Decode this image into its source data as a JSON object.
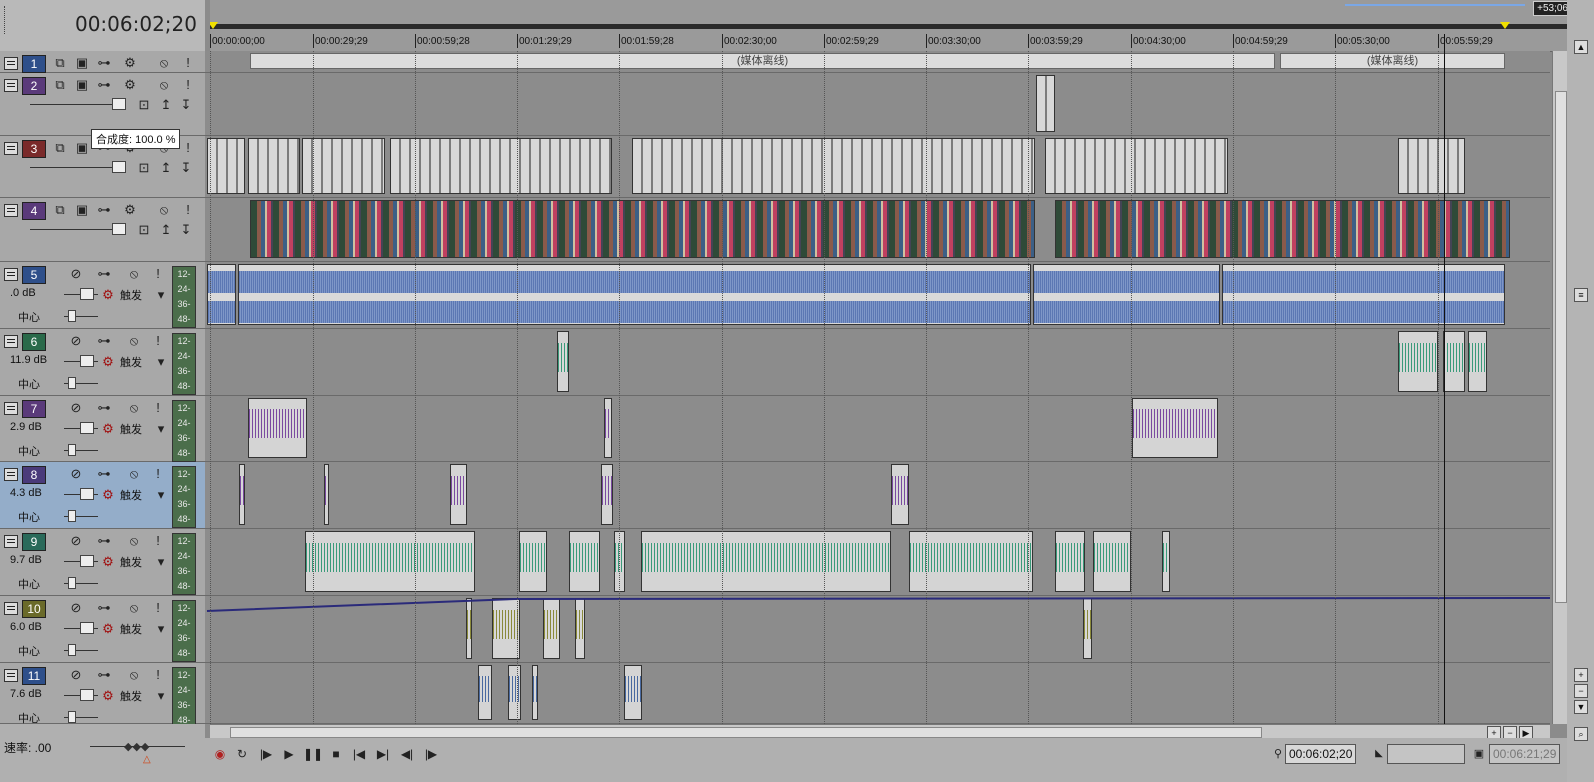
{
  "header": {
    "time": "00:06:02;20"
  },
  "ruler": {
    "labels": [
      "00:00:00;00",
      "00:00:29;29",
      "00:00:59;28",
      "00:01:29;29",
      "00:01:59;28",
      "00:02:30;00",
      "00:02:59;29",
      "00:03:30;00",
      "00:03:59;29",
      "00:04:30;00",
      "00:04:59;29",
      "00:05:30;00",
      "00:05:59;29"
    ],
    "end_badge": "+53;06"
  },
  "media_offline": [
    "(媒体离线)",
    "(媒体离线)"
  ],
  "tooltip": "合成度: 100.0 %",
  "tracks": [
    {
      "number": "1",
      "type": "video",
      "color": "#2e4f8a"
    },
    {
      "number": "2",
      "type": "video",
      "color": "#5a3a7a"
    },
    {
      "number": "3",
      "type": "video",
      "color": "#7a2a2a"
    },
    {
      "number": "4",
      "type": "video",
      "color": "#5a3a7a"
    },
    {
      "number": "5",
      "type": "audio",
      "color": "#2e4f8a",
      "db": ".0 dB",
      "pan": "中心",
      "trigger": "触发"
    },
    {
      "number": "6",
      "type": "audio",
      "color": "#2a6a4a",
      "db": "11.9 dB",
      "pan": "中心",
      "trigger": "触发"
    },
    {
      "number": "7",
      "type": "audio",
      "color": "#5a3a7a",
      "db": "2.9 dB",
      "pan": "中心",
      "trigger": "触发"
    },
    {
      "number": "8",
      "type": "audio",
      "color": "#4a3a7a",
      "db": "4.3 dB",
      "pan": "中心",
      "trigger": "触发"
    },
    {
      "number": "9",
      "type": "audio",
      "color": "#2a6a5a",
      "db": "9.7 dB",
      "pan": "中心",
      "trigger": "触发"
    },
    {
      "number": "10",
      "type": "audio",
      "color": "#6a6a2a",
      "db": "6.0 dB",
      "pan": "中心",
      "trigger": "触发"
    },
    {
      "number": "11",
      "type": "audio",
      "color": "#2e4f8a",
      "db": "7.6 dB",
      "pan": "中心",
      "trigger": "触发"
    }
  ],
  "meter_labels": [
    "12-",
    "24-",
    "36-",
    "48-"
  ],
  "footer": {
    "rate": "速率: .00",
    "current_time": "00:06:02;20",
    "end_time": "00:06:21;29"
  },
  "icons": {
    "record": "record-icon",
    "loop": "loop-icon",
    "play_from_start": "play-from-start-icon",
    "play": "play-icon",
    "pause": "pause-icon",
    "stop": "stop-icon",
    "prev": "previous-marker-icon",
    "next": "next-marker-icon",
    "frame_back": "frame-back-icon",
    "frame_fwd": "frame-forward-icon"
  }
}
